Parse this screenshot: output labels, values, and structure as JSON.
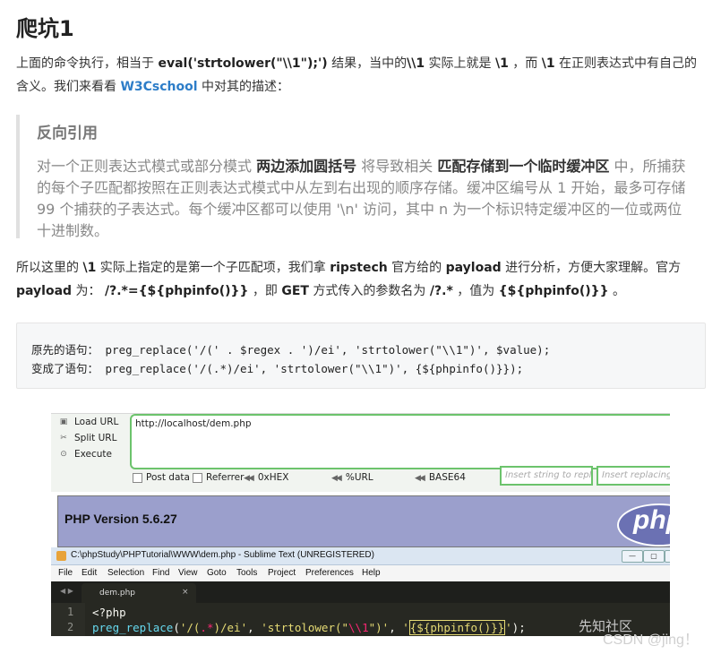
{
  "title": "爬坑1",
  "intro": {
    "p1_a": "上面的命令执行，相当于",
    "p1_code": "eval('strtolower(\"\\\\1\");')",
    "p1_b": "结果，当中的",
    "p1_c1": "\\\\1",
    "p1_c": "实际上就是",
    "p1_c2": "\\1",
    "p1_d": "，而",
    "p1_c3": "\\1",
    "p1_e": "在正则表达式中有自己的含义。我们来看看",
    "link": "W3Cschool",
    "p1_f": "中对其的描述："
  },
  "quote": {
    "heading": "反向引用",
    "t1": "对一个正则表达式模式或部分模式",
    "b1": "两边添加圆括号",
    "t2": "将导致相关",
    "b2": "匹配存储到一个临时缓冲区",
    "t3": "中，所捕获的每个子匹配都按照在正则表达式模式中从左到右出现的顺序存储。缓冲区编号从 1 开始，最多可存储 99 个捕获的子表达式。每个缓冲区都可以使用 '\\n' 访问，其中 n 为一个标识特定缓冲区的一位或两位十进制数。"
  },
  "para2": {
    "a": "所以这里的",
    "c1": "\\1",
    "b": "实际上指定的是第一个子匹配项，我们拿",
    "c2": "ripstech",
    "c": "官方给的",
    "c3": "payload",
    "d": "进行分析，方便大家理解。官方",
    "c4": "payload",
    "e": "为：",
    "c5": "/?.*={${phpinfo()}}",
    "f": "，即",
    "c6": "GET",
    "g": "方式传入的参数名为",
    "c7": "/?.*",
    "h": "，值为",
    "c8": "{${phpinfo()}}",
    "i": "。"
  },
  "code": {
    "line1": "原先的语句： preg_replace('/(' . $regex . ')/ei', 'strtolower(\"\\\\1\")', $value);",
    "line2": "变成了语句： preg_replace('/(.*)/ei', 'strtolower(\"\\\\1\")', {${phpinfo()}});"
  },
  "screenshot": {
    "hackbar": {
      "load_url": "Load URL",
      "split_url": "Split URL",
      "execute": "Execute",
      "url_value": "http://localhost/dem.php",
      "post_data": "Post data",
      "referrer": "Referrer",
      "hex": "0xHEX",
      "url_enc": "%URL",
      "base64": "BASE64",
      "insert_placeholder": "Insert string to replace",
      "insert_replacing_placeholder": "Insert replacing st"
    },
    "php_version": "PHP Version 5.6.27",
    "php_logo": "php",
    "sublime": {
      "window_title": "C:\\phpStudy\\PHPTutorial\\WWW\\dem.php - Sublime Text (UNREGISTERED)",
      "menu": [
        "File",
        "Edit",
        "Selection",
        "Find",
        "View",
        "Goto",
        "Tools",
        "Project",
        "Preferences",
        "Help"
      ],
      "tab_name": "dem.php",
      "tab_close": "×",
      "nav": "◀ ▶",
      "line_numbers": [
        "1",
        "2"
      ],
      "line1": "<?php",
      "line2_fn": "preg_replace",
      "line2_a": "(",
      "line2_s1a": "'/(",
      "line2_s1b": ".*",
      "line2_s1c": ")/ei'",
      "line2_b": ", ",
      "line2_s2a": "'strtolower(\"",
      "line2_s2b": "\\\\1",
      "line2_s2c": "\")'",
      "line2_c": ", ",
      "line2_s3a": "'",
      "line2_s3b": "{${phpinfo()}}",
      "line2_s3c": "'",
      "line2_d": ");"
    }
  },
  "watermarks": {
    "xz": "先知社区",
    "csdn": "CSDN @jing！"
  }
}
